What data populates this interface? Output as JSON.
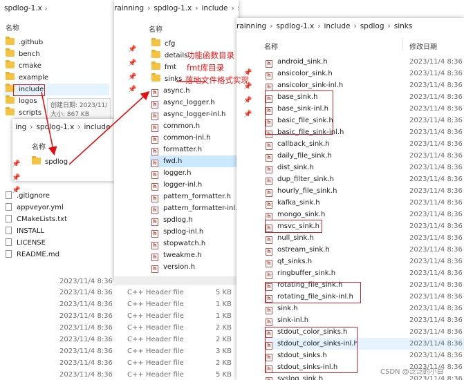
{
  "background_list": {
    "rows": [
      {
        "date": "2023/11/4 8:36",
        "type": "C++ Header file",
        "size": "5 KB"
      },
      {
        "date": "2023/11/4 8:36",
        "type": "C++ Header file",
        "size": "1 KB"
      },
      {
        "date": "2023/11/4 8:36",
        "type": "C++ Header file",
        "size": "1 KB"
      },
      {
        "date": "2023/11/4 8:36",
        "type": "C++ Header file",
        "size": "2 KB"
      },
      {
        "date": "2023/11/4 8:36",
        "type": "C++ Header file",
        "size": "2 KB"
      },
      {
        "date": "2023/11/4 8:36",
        "type": "C++ Header file",
        "size": "3 KB"
      },
      {
        "date": "2023/11/4 8:36",
        "type": "C++ Header file",
        "size": "2 KB"
      },
      {
        "date": "2023/11/4 8:36",
        "type": "C++ Header file",
        "size": "5 KB"
      }
    ],
    "partial_date": "2023/11/4 8:36"
  },
  "win1": {
    "crumbs": [
      "spdlog-1.x"
    ],
    "col_name": "名称",
    "items": [
      {
        "name": ".github",
        "kind": "folder"
      },
      {
        "name": "bench",
        "kind": "folder"
      },
      {
        "name": "cmake",
        "kind": "folder"
      },
      {
        "name": "example",
        "kind": "folder"
      },
      {
        "name": "include",
        "kind": "folder"
      },
      {
        "name": "logos",
        "kind": "folder"
      },
      {
        "name": "scripts",
        "kind": "folder"
      }
    ],
    "bottom_items": [
      {
        "name": ".gitignore",
        "kind": "file"
      },
      {
        "name": "appveyor.yml",
        "kind": "file"
      },
      {
        "name": "CMakeLists.txt",
        "kind": "file"
      },
      {
        "name": "INSTALL",
        "kind": "file"
      },
      {
        "name": "LICENSE",
        "kind": "file"
      },
      {
        "name": "README.md",
        "kind": "file"
      }
    ],
    "tooltip_line1": "创建日期: 2023/11/",
    "tooltip_line2": "大小: 867 KB",
    "peek_text": "023112"
  },
  "win_mid_small": {
    "crumbs": [
      "ing",
      "spdlog-1.x",
      "include"
    ],
    "col_name": "名称",
    "items": [
      {
        "name": "spdlog",
        "kind": "folder"
      }
    ]
  },
  "win2": {
    "crumbs": [
      "rainning",
      "spdlog-1.x",
      "include",
      "spdlog"
    ],
    "col_name": "名称",
    "items": [
      {
        "name": "cfg",
        "kind": "folder"
      },
      {
        "name": "details",
        "kind": "folder"
      },
      {
        "name": "fmt",
        "kind": "folder"
      },
      {
        "name": "sinks",
        "kind": "folder"
      },
      {
        "name": "async.h",
        "kind": "header"
      },
      {
        "name": "async_logger.h",
        "kind": "header"
      },
      {
        "name": "async_logger-inl.h",
        "kind": "header"
      },
      {
        "name": "common.h",
        "kind": "header"
      },
      {
        "name": "common-inl.h",
        "kind": "header"
      },
      {
        "name": "formatter.h",
        "kind": "header"
      },
      {
        "name": "fwd.h",
        "kind": "header"
      },
      {
        "name": "logger.h",
        "kind": "header"
      },
      {
        "name": "logger-inl.h",
        "kind": "header"
      },
      {
        "name": "pattern_formatter.h",
        "kind": "header"
      },
      {
        "name": "pattern_formatter-inl.h",
        "kind": "header"
      },
      {
        "name": "spdlog.h",
        "kind": "header"
      },
      {
        "name": "spdlog-inl.h",
        "kind": "header"
      },
      {
        "name": "stopwatch.h",
        "kind": "header"
      },
      {
        "name": "tweakme.h",
        "kind": "header"
      },
      {
        "name": "version.h",
        "kind": "header"
      }
    ],
    "peek_text": "3112"
  },
  "win3": {
    "crumbs": [
      "rainning",
      "spdlog-1.x",
      "include",
      "spdlog",
      "sinks"
    ],
    "col_name": "名称",
    "col_date": "修改日期",
    "date_value": "2023/11/4 8:36",
    "items": [
      "android_sink.h",
      "ansicolor_sink.h",
      "ansicolor_sink-inl.h",
      "base_sink.h",
      "base_sink-inl.h",
      "basic_file_sink.h",
      "basic_file_sink-inl.h",
      "callback_sink.h",
      "daily_file_sink.h",
      "dist_sink.h",
      "dup_filter_sink.h",
      "hourly_file_sink.h",
      "kafka_sink.h",
      "mongo_sink.h",
      "msvc_sink.h",
      "null_sink.h",
      "ostream_sink.h",
      "qt_sinks.h",
      "ringbuffer_sink.h",
      "rotating_file_sink.h",
      "rotating_file_sink-inl.h",
      "sink.h",
      "sink-inl.h",
      "stdout_color_sinks.h",
      "stdout_color_sinks-inl.h",
      "stdout_sinks.h",
      "stdout_sinks-inl.h",
      "syslog_sink.h"
    ]
  },
  "annotations": {
    "note1": "功能函数目录",
    "note2": "fmt库目录",
    "note3": "落地文件格式实现",
    "accent": "#e11111"
  },
  "watermark": "CSDN @泛泛的小白"
}
